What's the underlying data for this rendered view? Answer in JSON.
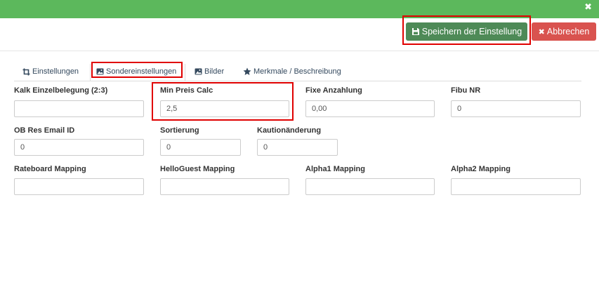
{
  "header": {
    "close_symbol": "✖"
  },
  "toolbar": {
    "save_label": "Speichern der Einstellung",
    "cancel_label": "Abbrechen",
    "cancel_symbol": "✖"
  },
  "tabs": [
    {
      "label": "Einstellungen",
      "icon": "crop-icon"
    },
    {
      "label": "Sondereinstellungen",
      "icon": "image-icon",
      "active": true
    },
    {
      "label": "Bilder",
      "icon": "image-icon"
    },
    {
      "label": "Merkmale / Beschreibung",
      "icon": "star-icon"
    }
  ],
  "fields": {
    "kalk_einzelbelegung": {
      "label": "Kalk Einzelbelegung (2:3)",
      "value": ""
    },
    "min_preis_calc": {
      "label": "Min Preis Calc",
      "value": "2,5"
    },
    "fixe_anzahlung": {
      "label": "Fixe Anzahlung",
      "value": "0,00"
    },
    "fibu_nr": {
      "label": "Fibu NR",
      "value": "0"
    },
    "ob_res_email_id": {
      "label": "OB Res Email ID",
      "value": "0"
    },
    "sortierung": {
      "label": "Sortierung",
      "value": "0"
    },
    "kautionaenderung": {
      "label": "Kautionänderung",
      "value": "0"
    },
    "rateboard_mapping": {
      "label": "Rateboard Mapping",
      "value": ""
    },
    "helloguest_mapping": {
      "label": "HelloGuest Mapping",
      "value": ""
    },
    "alpha1_mapping": {
      "label": "Alpha1 Mapping",
      "value": ""
    },
    "alpha2_mapping": {
      "label": "Alpha2 Mapping",
      "value": ""
    }
  },
  "colors": {
    "header_bg": "#5cb85c",
    "save_button": "#4e8a57",
    "cancel_button": "#d9534f",
    "highlight": "#e00000"
  }
}
